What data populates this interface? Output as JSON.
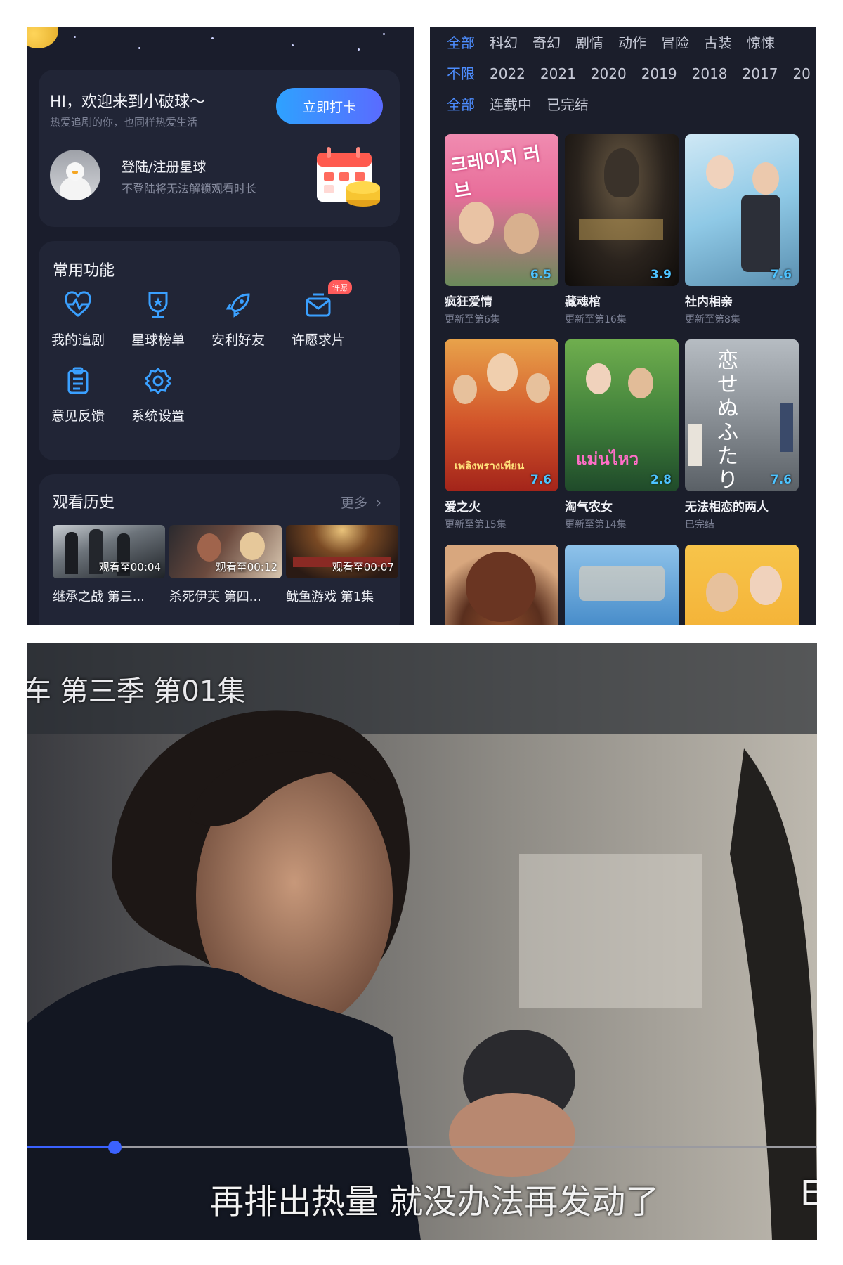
{
  "left_panel": {
    "welcome": {
      "title": "HI，欢迎来到小破球～",
      "subtitle": "热爱追剧的你，也同样热爱生活",
      "checkin_button": "立即打卡",
      "login_title": "登陆/注册星球",
      "login_subtitle": "不登陆将无法解锁观看时长"
    },
    "functions": {
      "title": "常用功能",
      "items": [
        {
          "label": "我的追剧",
          "icon": "heart-pulse-icon"
        },
        {
          "label": "星球榜单",
          "icon": "trophy-icon"
        },
        {
          "label": "安利好友",
          "icon": "rocket-icon"
        },
        {
          "label": "许愿求片",
          "icon": "envelope-icon",
          "badge": "许愿"
        },
        {
          "label": "意见反馈",
          "icon": "clipboard-icon"
        },
        {
          "label": "系统设置",
          "icon": "gear-icon"
        }
      ]
    },
    "history": {
      "title": "观看历史",
      "more": "更多",
      "items": [
        {
          "progress": "观看至00:04",
          "name": "继承之战 第三..."
        },
        {
          "progress": "观看至00:12",
          "name": "杀死伊芙 第四..."
        },
        {
          "progress": "观看至00:07",
          "name": "鱿鱼游戏 第1集"
        }
      ]
    }
  },
  "right_panel": {
    "genres": [
      "全部",
      "科幻",
      "奇幻",
      "剧情",
      "动作",
      "冒险",
      "古装",
      "惊悚"
    ],
    "years": [
      "不限",
      "2022",
      "2021",
      "2020",
      "2019",
      "2018",
      "2017",
      "20"
    ],
    "statuses": [
      "全部",
      "连载中",
      "已完结"
    ],
    "posters": [
      {
        "title": "疯狂爱情",
        "status": "更新至第6集",
        "score": "6.5",
        "color": "#e86e9a"
      },
      {
        "title": "藏魂棺",
        "status": "更新至第16集",
        "score": "3.9",
        "color": "#2a231d"
      },
      {
        "title": "社内相亲",
        "status": "更新至第8集",
        "score": "7.6",
        "color": "#8fc9e6"
      },
      {
        "title": "爱之火",
        "status": "更新至第15集",
        "score": "7.6",
        "color": "#d2542a"
      },
      {
        "title": "淘气农女",
        "status": "更新至第14集",
        "score": "2.8",
        "color": "#3f7f3a"
      },
      {
        "title": "无法相恋的两人",
        "status": "已完结",
        "score": "7.6",
        "color": "#8a9096"
      },
      {
        "title": "",
        "status": "",
        "score": "",
        "color": "#c98b63"
      },
      {
        "title": "",
        "status": "",
        "score": "",
        "color": "#3f86c6"
      },
      {
        "title": "",
        "status": "",
        "score": "",
        "color": "#f2a62a"
      }
    ],
    "poster_text": {
      "p1": "크레이지 러브",
      "p4": "เพลิงพรางเทียน",
      "p5": "แม่นไหว",
      "p6": "恋せぬふたり"
    }
  },
  "video": {
    "episode_title": "车 第三季 第01集",
    "subtitle": "再排出热量 就没办法再发动了",
    "subtitle_edge": "E",
    "progress": 0.11
  }
}
